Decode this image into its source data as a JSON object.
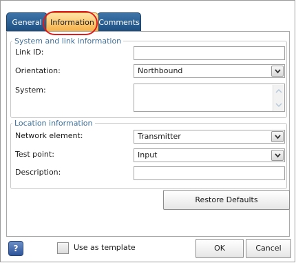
{
  "tabs": [
    {
      "label": "General"
    },
    {
      "label": "Information",
      "active": true
    },
    {
      "label": "Comments"
    }
  ],
  "system_group": {
    "legend": "System and link information",
    "link_id_label": "Link ID:",
    "link_id_value": "",
    "orientation_label": "Orientation:",
    "orientation_value": "Northbound",
    "system_label": "System:",
    "system_value": ""
  },
  "location_group": {
    "legend": "Location information",
    "network_element_label": "Network element:",
    "network_element_value": "Transmitter",
    "test_point_label": "Test point:",
    "test_point_value": "Input",
    "description_label": "Description:",
    "description_value": ""
  },
  "buttons": {
    "restore_defaults": "Restore Defaults",
    "ok": "OK",
    "cancel": "Cancel"
  },
  "footer": {
    "help_glyph": "?",
    "use_as_template_label": "Use as template",
    "use_as_template_checked": false
  },
  "colors": {
    "tab_active": "#f6b24a",
    "tab_inactive": "#1e4f82",
    "highlight_ring": "#e01b1b",
    "legend_text": "#3f6f9a"
  },
  "icons": {
    "combo_arrow": "chevron-down-icon",
    "help": "help-icon",
    "scroll_up": "scroll-up-icon",
    "scroll_down": "scroll-down-icon"
  }
}
